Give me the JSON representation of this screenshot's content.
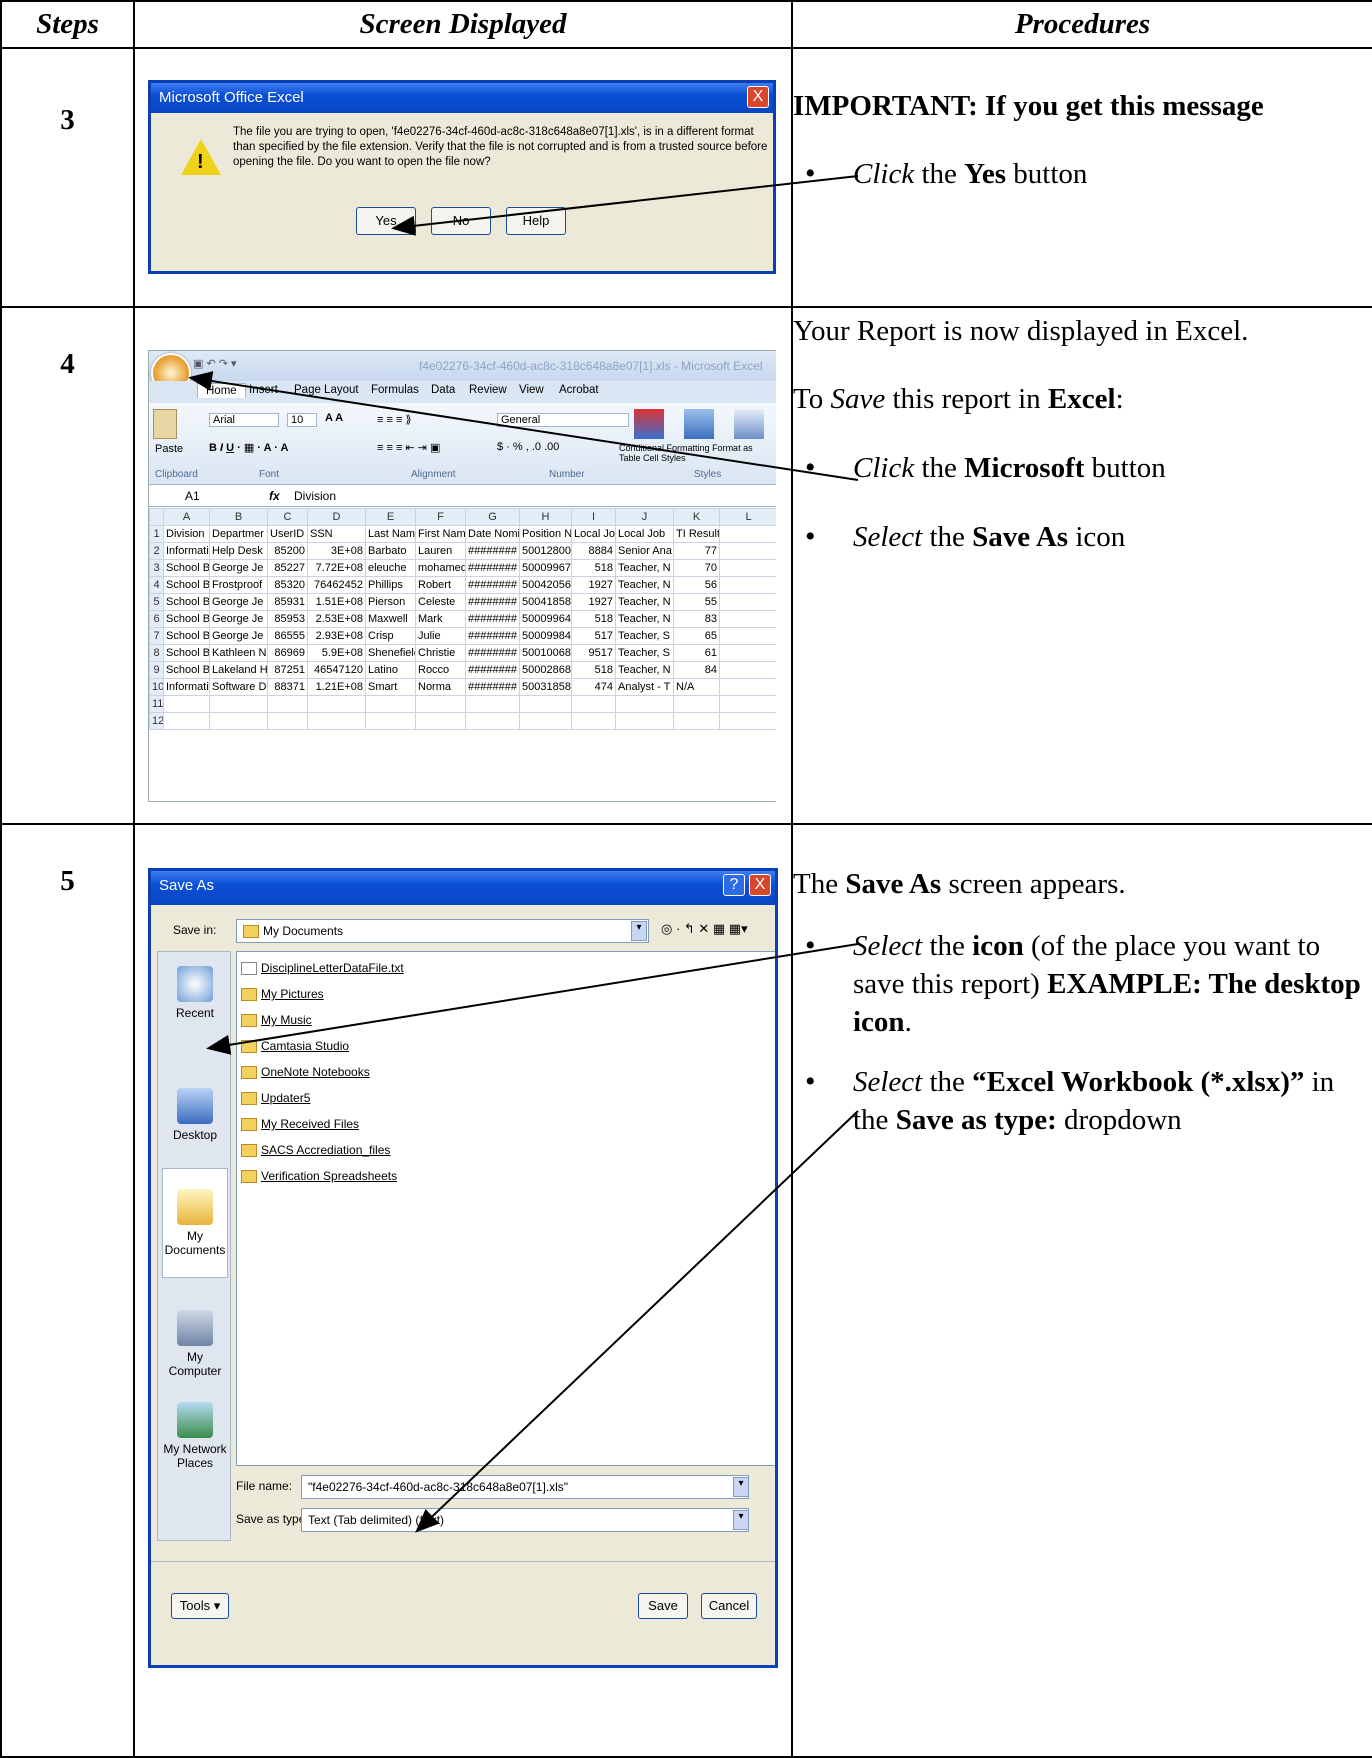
{
  "table": {
    "headers": [
      "Steps",
      "Screen Displayed",
      "Procedures"
    ]
  },
  "step3": {
    "number": "3",
    "dialog": {
      "title": "Microsoft Office Excel",
      "message": "The file you are trying to open, 'f4e02276-34cf-460d-ac8c-318c648a8e07[1].xls', is in a different format than specified by the file extension. Verify that the file is not corrupted and is from a trusted source before opening the file. Do you want to open the file now?",
      "buttons": [
        "Yes",
        "No",
        "Help"
      ],
      "close": "X"
    },
    "procedure": {
      "heading": "IMPORTANT:  If you get this message",
      "bullet_verb": "Click",
      "bullet_mid": " the ",
      "bullet_bold": "Yes",
      "bullet_end": " button"
    }
  },
  "step4": {
    "number": "4",
    "excel": {
      "title": "f4e02276-34cf-460d-ac8c-318c648a8e07[1].xls  -  Microsoft Excel",
      "tabs": [
        "Home",
        "Insert",
        "Page Layout",
        "Formulas",
        "Data",
        "Review",
        "View",
        "Acrobat"
      ],
      "font_name": "Arial",
      "font_size": "10",
      "number_format": "General",
      "groups": [
        "Clipboard",
        "Font",
        "Alignment",
        "Number",
        "Styles"
      ],
      "paste_label": "Paste",
      "styles_labels": [
        "Conditional Formatting",
        "Format as Table",
        "Cell Styles"
      ],
      "name_box": "A1",
      "formula_value": "Division",
      "columns": [
        "A",
        "B",
        "C",
        "D",
        "E",
        "F",
        "G",
        "H",
        "I",
        "J",
        "K",
        "L"
      ],
      "rows": [
        [
          "1",
          "Division",
          "Departmer",
          "UserID",
          "SSN",
          "Last Name",
          "First Name",
          "Date Nomi",
          "Position N",
          "Local Job",
          "Local Job",
          "TI Result"
        ],
        [
          "2",
          "Informatior",
          "Help Desk",
          "85200",
          "3E+08",
          "Barbato",
          "Lauren",
          "########",
          "50012800",
          "8884",
          "Senior Ana",
          "77"
        ],
        [
          "3",
          "School Ba",
          "George Je",
          "85227",
          "7.72E+08",
          "eleuche",
          "mohamed",
          "########",
          "50009967",
          "518",
          "Teacher, N",
          "70"
        ],
        [
          "4",
          "School Ba",
          "Frostproof",
          "85320",
          "76462452",
          "Phillips",
          "Robert",
          "########",
          "50042056",
          "1927",
          "Teacher, N",
          "56"
        ],
        [
          "5",
          "School Ba",
          "George Je",
          "85931",
          "1.51E+08",
          "Pierson",
          "Celeste",
          "########",
          "50041858",
          "1927",
          "Teacher, N",
          "55"
        ],
        [
          "6",
          "School Ba",
          "George Je",
          "85953",
          "2.53E+08",
          "Maxwell",
          "Mark",
          "########",
          "50009964",
          "518",
          "Teacher, N",
          "83"
        ],
        [
          "7",
          "School Ba",
          "George Je",
          "86555",
          "2.93E+08",
          "Crisp",
          "Julie",
          "########",
          "50009984",
          "517",
          "Teacher, S",
          "65"
        ],
        [
          "8",
          "School Ba",
          "Kathleen N",
          "86969",
          "5.9E+08",
          "Shenefield",
          "Christie",
          "########",
          "50010068",
          "9517",
          "Teacher, S",
          "61"
        ],
        [
          "9",
          "School Ba",
          "Lakeland H",
          "87251",
          "46547120",
          "Latino",
          "Rocco",
          "########",
          "50002868",
          "518",
          "Teacher, N",
          "84"
        ],
        [
          "10",
          "Informatior",
          "Software D",
          "88371",
          "1.21E+08",
          "Smart",
          "Norma",
          "########",
          "50031858",
          "474",
          "Analyst - T",
          "N/A"
        ],
        [
          "11",
          "",
          "",
          "",
          "",
          "",
          "",
          "",
          "",
          "",
          "",
          ""
        ],
        [
          "12",
          "",
          "",
          "",
          "",
          "",
          "",
          "",
          "",
          "",
          "",
          ""
        ]
      ]
    },
    "procedure": {
      "intro": "Your Report is now displayed in Excel.",
      "save_pre": "To ",
      "save_em": "Save",
      "save_mid": " this report in ",
      "save_bold": "Excel",
      "save_end": ":",
      "b1_verb": "Click",
      "b1_mid": " the ",
      "b1_bold": "Microsoft",
      "b1_end": " button",
      "b2_verb": "Select",
      "b2_mid": " the ",
      "b2_bold": "Save As",
      "b2_end": " icon"
    }
  },
  "step5": {
    "number": "5",
    "saveas": {
      "title": "Save As",
      "save_in_label": "Save in:",
      "save_in_value": "My Documents",
      "files": [
        "DisciplineLetterDataFile.txt",
        "My Pictures",
        "My Music",
        "Camtasia Studio",
        "OneNote Notebooks",
        "Updater5",
        "My Received Files",
        "SACS Accrediation_files",
        "Verification Spreadsheets"
      ],
      "places": [
        "Recent",
        "Desktop",
        "My Documents",
        "My Computer",
        "My Network Places"
      ],
      "filename_label": "File name:",
      "filename_value": "\"f4e02276-34cf-460d-ac8c-318c648a8e07[1].xls\"",
      "savetype_label": "Save as type:",
      "savetype_value": "Text (Tab delimited) (*.txt)",
      "tools": "Tools",
      "save_btn": "Save",
      "cancel_btn": "Cancel"
    },
    "procedure": {
      "intro_pre": "The ",
      "intro_bold": "Save As",
      "intro_end": " screen appears.",
      "b1_verb": "Select",
      "b1_mid": " the ",
      "b1_bold": "icon",
      "b1_end": " (of the place you want to save this report)",
      "b1_example": "EXAMPLE: The desktop icon",
      "b1_period": ".",
      "b2_verb": "Select",
      "b2_mid": " the ",
      "b2_bold": "“Excel Workbook (*.xlsx)”",
      "b2_mid2": " in the ",
      "b2_bold2": "Save as type:",
      "b2_end": " dropdown"
    }
  }
}
